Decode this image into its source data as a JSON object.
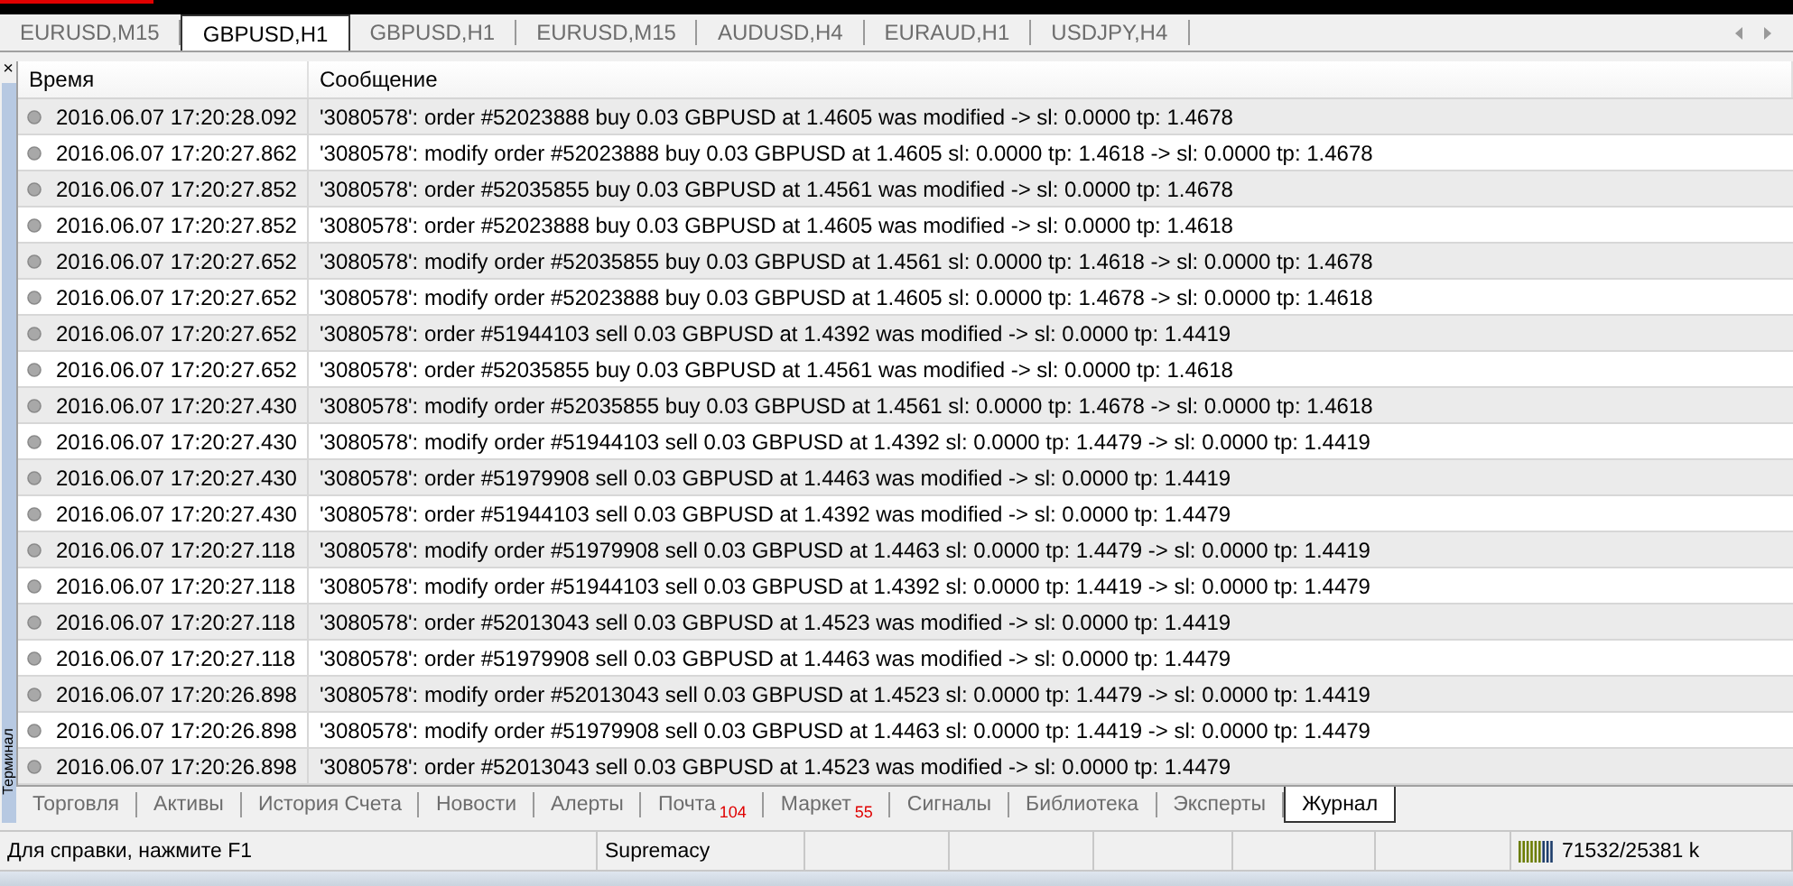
{
  "chart_tabs": [
    {
      "label": "EURUSD,M15",
      "selected": false
    },
    {
      "label": "GBPUSD,H1",
      "selected": true
    },
    {
      "label": "GBPUSD,H1",
      "selected": false
    },
    {
      "label": "EURUSD,M15",
      "selected": false
    },
    {
      "label": "AUDUSD,H4",
      "selected": false
    },
    {
      "label": "EURAUD,H1",
      "selected": false
    },
    {
      "label": "USDJPY,H4",
      "selected": false
    }
  ],
  "terminal": {
    "title": "Терминал",
    "close": "×"
  },
  "journal": {
    "columns": [
      "Время",
      "Сообщение"
    ],
    "rows": [
      {
        "time": "2016.06.07 17:20:28.092",
        "message": "'3080578': order #52023888 buy 0.03 GBPUSD at 1.4605 was modified -> sl: 0.0000 tp: 1.4678"
      },
      {
        "time": "2016.06.07 17:20:27.862",
        "message": "'3080578': modify order #52023888 buy 0.03 GBPUSD at 1.4605 sl: 0.0000 tp: 1.4618 -> sl: 0.0000 tp: 1.4678"
      },
      {
        "time": "2016.06.07 17:20:27.852",
        "message": "'3080578': order #52035855 buy 0.03 GBPUSD at 1.4561 was modified -> sl: 0.0000 tp: 1.4678"
      },
      {
        "time": "2016.06.07 17:20:27.852",
        "message": "'3080578': order #52023888 buy 0.03 GBPUSD at 1.4605 was modified -> sl: 0.0000 tp: 1.4618"
      },
      {
        "time": "2016.06.07 17:20:27.652",
        "message": "'3080578': modify order #52035855 buy 0.03 GBPUSD at 1.4561 sl: 0.0000 tp: 1.4618 -> sl: 0.0000 tp: 1.4678"
      },
      {
        "time": "2016.06.07 17:20:27.652",
        "message": "'3080578': modify order #52023888 buy 0.03 GBPUSD at 1.4605 sl: 0.0000 tp: 1.4678 -> sl: 0.0000 tp: 1.4618"
      },
      {
        "time": "2016.06.07 17:20:27.652",
        "message": "'3080578': order #51944103 sell 0.03 GBPUSD at 1.4392 was modified -> sl: 0.0000 tp: 1.4419"
      },
      {
        "time": "2016.06.07 17:20:27.652",
        "message": "'3080578': order #52035855 buy 0.03 GBPUSD at 1.4561 was modified -> sl: 0.0000 tp: 1.4618"
      },
      {
        "time": "2016.06.07 17:20:27.430",
        "message": "'3080578': modify order #52035855 buy 0.03 GBPUSD at 1.4561 sl: 0.0000 tp: 1.4678 -> sl: 0.0000 tp: 1.4618"
      },
      {
        "time": "2016.06.07 17:20:27.430",
        "message": "'3080578': modify order #51944103 sell 0.03 GBPUSD at 1.4392 sl: 0.0000 tp: 1.4479 -> sl: 0.0000 tp: 1.4419"
      },
      {
        "time": "2016.06.07 17:20:27.430",
        "message": "'3080578': order #51979908 sell 0.03 GBPUSD at 1.4463 was modified -> sl: 0.0000 tp: 1.4419"
      },
      {
        "time": "2016.06.07 17:20:27.430",
        "message": "'3080578': order #51944103 sell 0.03 GBPUSD at 1.4392 was modified -> sl: 0.0000 tp: 1.4479"
      },
      {
        "time": "2016.06.07 17:20:27.118",
        "message": "'3080578': modify order #51979908 sell 0.03 GBPUSD at 1.4463 sl: 0.0000 tp: 1.4479 -> sl: 0.0000 tp: 1.4419"
      },
      {
        "time": "2016.06.07 17:20:27.118",
        "message": "'3080578': modify order #51944103 sell 0.03 GBPUSD at 1.4392 sl: 0.0000 tp: 1.4419 -> sl: 0.0000 tp: 1.4479"
      },
      {
        "time": "2016.06.07 17:20:27.118",
        "message": "'3080578': order #52013043 sell 0.03 GBPUSD at 1.4523 was modified -> sl: 0.0000 tp: 1.4419"
      },
      {
        "time": "2016.06.07 17:20:27.118",
        "message": "'3080578': order #51979908 sell 0.03 GBPUSD at 1.4463 was modified -> sl: 0.0000 tp: 1.4479"
      },
      {
        "time": "2016.06.07 17:20:26.898",
        "message": "'3080578': modify order #52013043 sell 0.03 GBPUSD at 1.4523 sl: 0.0000 tp: 1.4479 -> sl: 0.0000 tp: 1.4419"
      },
      {
        "time": "2016.06.07 17:20:26.898",
        "message": "'3080578': modify order #51979908 sell 0.03 GBPUSD at 1.4463 sl: 0.0000 tp: 1.4419 -> sl: 0.0000 tp: 1.4479"
      },
      {
        "time": "2016.06.07 17:20:26.898",
        "message": "'3080578': order #52013043 sell 0.03 GBPUSD at 1.4523 was modified -> sl: 0.0000 tp: 1.4479"
      }
    ]
  },
  "terminal_tabs": [
    {
      "label": "Торговля",
      "selected": false
    },
    {
      "label": "Активы",
      "selected": false
    },
    {
      "label": "История Счета",
      "selected": false
    },
    {
      "label": "Новости",
      "selected": false
    },
    {
      "label": "Алерты",
      "selected": false
    },
    {
      "label": "Почта",
      "badge": "104",
      "selected": false
    },
    {
      "label": "Маркет",
      "badge": "55",
      "selected": false
    },
    {
      "label": "Сигналы",
      "selected": false
    },
    {
      "label": "Библиотека",
      "selected": false
    },
    {
      "label": "Эксперты",
      "selected": false
    },
    {
      "label": "Журнал",
      "selected": true
    }
  ],
  "status_bar": {
    "help": "Для справки, нажмите F1",
    "profile": "Supremacy",
    "traffic": "71532/25381 k"
  }
}
